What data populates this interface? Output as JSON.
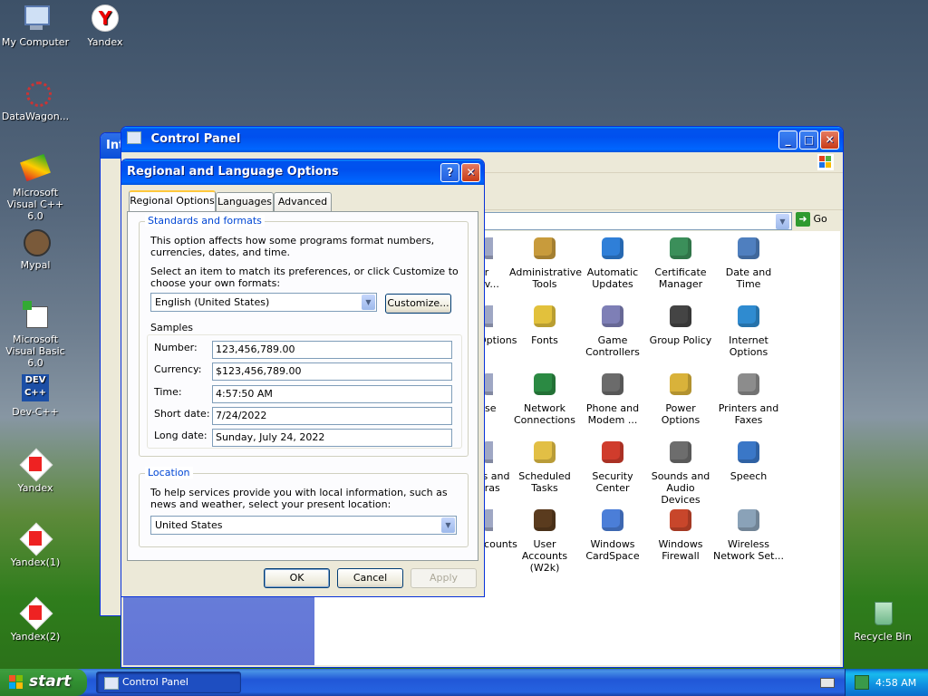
{
  "desktop": {
    "icons": [
      {
        "label": "My Computer",
        "icon": "my-computer-icon"
      },
      {
        "label": "Yandex",
        "icon": "yandex-icon"
      },
      {
        "label": "DataWagon...",
        "icon": "datawagon-icon"
      },
      {
        "label": "Microsoft Visual C++ 6.0",
        "icon": "visual-cpp-icon"
      },
      {
        "label": "Mypal",
        "icon": "mypal-icon"
      },
      {
        "label": "Microsoft Visual Basic 6.0",
        "icon": "visual-basic-icon"
      },
      {
        "label": "Dev-C++",
        "icon": "devcpp-icon"
      },
      {
        "label": "Yandex",
        "icon": "yandex-icon"
      },
      {
        "label": "Yandex(1)",
        "icon": "yandex-icon"
      },
      {
        "label": "Yandex(2)",
        "icon": "yandex-icon"
      },
      {
        "label": "Recycle Bin",
        "icon": "recycle-bin-icon"
      }
    ]
  },
  "back_window": {
    "title_fragment": "Int"
  },
  "control_panel": {
    "title": "Control Panel",
    "go_label": "Go",
    "items": [
      {
        "label": "or\nov...",
        "icon": "partial-icon"
      },
      {
        "label": "Administrative Tools",
        "icon": "admin-tools-icon"
      },
      {
        "label": "Automatic Updates",
        "icon": "automatic-updates-icon"
      },
      {
        "label": "Certificate Manager",
        "icon": "certificate-icon"
      },
      {
        "label": "Date and Time",
        "icon": "date-time-icon"
      },
      {
        "label": "Options",
        "icon": "partial-icon"
      },
      {
        "label": "Fonts",
        "icon": "fonts-icon"
      },
      {
        "label": "Game Controllers",
        "icon": "game-controllers-icon"
      },
      {
        "label": "Group Policy",
        "icon": "group-policy-icon"
      },
      {
        "label": "Internet Options",
        "icon": "internet-options-icon"
      },
      {
        "label": "use",
        "icon": "partial-icon"
      },
      {
        "label": "Network Connections",
        "icon": "network-icon"
      },
      {
        "label": "Phone and Modem ...",
        "icon": "phone-modem-icon"
      },
      {
        "label": "Power Options",
        "icon": "power-options-icon"
      },
      {
        "label": "Printers and Faxes",
        "icon": "printers-icon"
      },
      {
        "label": "rs and\neras",
        "icon": "partial-icon"
      },
      {
        "label": "Scheduled Tasks",
        "icon": "scheduled-tasks-icon"
      },
      {
        "label": "Security Center",
        "icon": "security-center-icon"
      },
      {
        "label": "Sounds and Audio Devices",
        "icon": "sounds-icon"
      },
      {
        "label": "Speech",
        "icon": "speech-icon"
      },
      {
        "label": "ccounts",
        "icon": "partial-icon"
      },
      {
        "label": "User Accounts (W2k)",
        "icon": "user-accounts-icon"
      },
      {
        "label": "Windows CardSpace",
        "icon": "cardspace-icon"
      },
      {
        "label": "Windows Firewall",
        "icon": "firewall-icon"
      },
      {
        "label": "Wireless Network Set...",
        "icon": "wireless-icon"
      }
    ]
  },
  "dialog": {
    "title": "Regional and Language Options",
    "tabs": [
      "Regional Options",
      "Languages",
      "Advanced"
    ],
    "standards": {
      "group_label": "Standards and formats",
      "description": "This option affects how some programs format numbers, currencies, dates, and time.",
      "select_prompt": "Select an item to match its preferences, or click Customize to choose your own formats:",
      "selected_format": "English (United States)",
      "customize_label": "Customize...",
      "samples_label": "Samples",
      "samples": [
        {
          "label": "Number:",
          "value": "123,456,789.00"
        },
        {
          "label": "Currency:",
          "value": "$123,456,789.00"
        },
        {
          "label": "Time:",
          "value": "4:57:50 AM"
        },
        {
          "label": "Short date:",
          "value": "7/24/2022"
        },
        {
          "label": "Long date:",
          "value": "Sunday, July 24, 2022"
        }
      ]
    },
    "location": {
      "group_label": "Location",
      "description": "To help services provide you with local information, such as news and weather, select your present location:",
      "selected": "United States"
    },
    "ok_label": "OK",
    "cancel_label": "Cancel",
    "apply_label": "Apply"
  },
  "taskbar": {
    "start_label": "start",
    "task_label": "Control Panel",
    "clock": "4:58 AM"
  }
}
